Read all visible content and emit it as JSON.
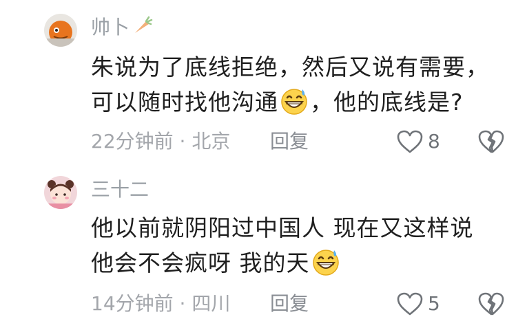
{
  "comments": [
    {
      "username": "帅卜",
      "badge_icon": "carrot-icon",
      "lines": [
        "朱说为了底线拒绝，然后又说有需要，",
        "可以随时找他沟通",
        "，他的底线是?"
      ],
      "meta": "22分钟前 · 北京",
      "reply_label": "回复",
      "likes": "8"
    },
    {
      "username": "三十二",
      "lines": [
        "他以前就阴阳过中国人 现在又这样说",
        "他会不会疯呀 我的天"
      ],
      "meta": "14分钟前 · 四川",
      "reply_label": "回复",
      "likes": "5"
    }
  ],
  "colors": {
    "text": "#1f1f1f",
    "meta": "#a3a6ab",
    "icon": "#6f7378"
  }
}
